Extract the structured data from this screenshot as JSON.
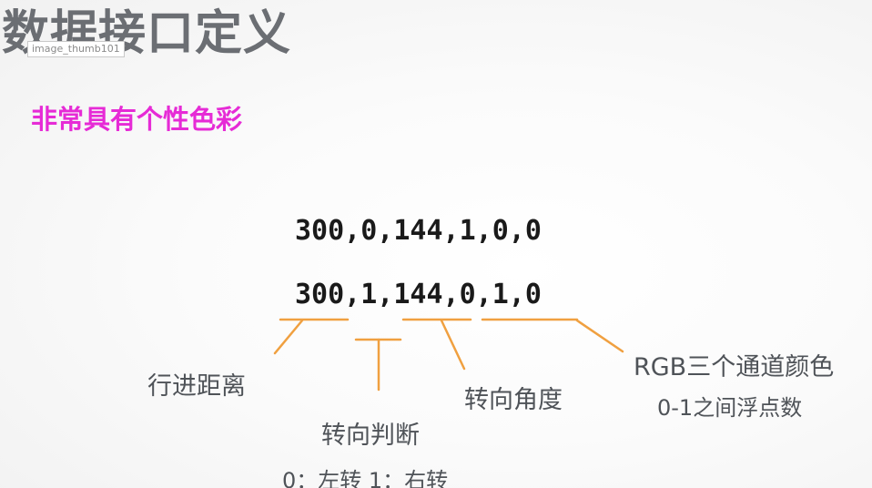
{
  "slide": {
    "title": "数据接口定义",
    "thumbnail_label": "image_thumb101",
    "subtitle": "非常具有个性色彩",
    "code_lines": [
      "300,0,144,1,0,0",
      "300,1,144,0,1,0"
    ],
    "annotations": {
      "distance": "行进距离",
      "turn_judgement": "转向判断",
      "turn_judgement_note": "0：左转 1：右转",
      "turn_angle": "转向角度",
      "rgb_title": "RGB三个通道颜色",
      "rgb_note": "0-1之间浮点数"
    },
    "colors": {
      "title": "#6b6e73",
      "subtitle": "#e62bd6",
      "connector": "#f0a040",
      "label": "#4f5358",
      "code": "#1a1a1a"
    }
  }
}
